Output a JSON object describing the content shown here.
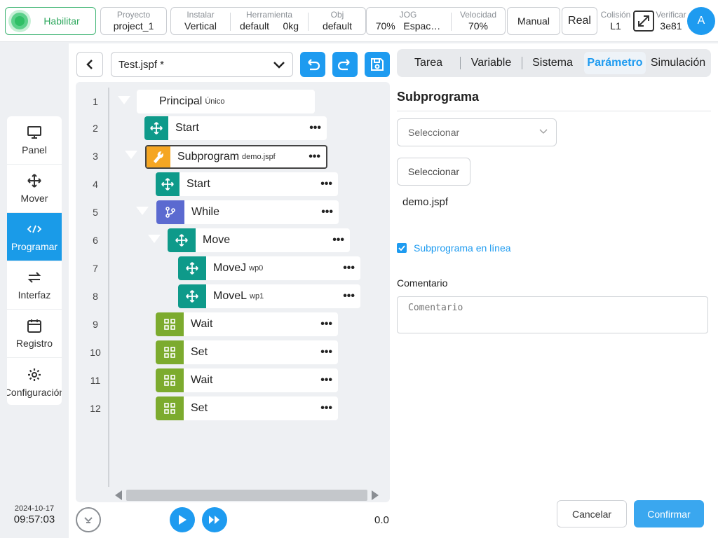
{
  "topbar": {
    "enable_label": "Habilitar",
    "project": {
      "label": "Proyecto",
      "value": "project_1"
    },
    "install": {
      "label": "Instalar",
      "value": "Vertical"
    },
    "tool": {
      "label": "Herramienta",
      "value": "default",
      "payload": "0kg"
    },
    "obj": {
      "label": "Obj",
      "value": "default"
    },
    "jog": {
      "label": "JOG",
      "value": "70%",
      "frame": "Espac…"
    },
    "speed": {
      "label": "Velocidad",
      "value": "70%"
    },
    "mode_manual": "Manual",
    "mode_real": "Real",
    "collision": {
      "label": "Colisión",
      "value": "L1"
    },
    "verify": {
      "label": "Verificar",
      "value": "3e81"
    },
    "avatar": "A",
    "expand_icon": "expand-icon"
  },
  "sidebar": {
    "items": [
      {
        "label": "Panel",
        "icon": "monitor-icon"
      },
      {
        "label": "Mover",
        "icon": "move-arrows-icon"
      },
      {
        "label": "Programar",
        "icon": "code-icon"
      },
      {
        "label": "Interfaz",
        "icon": "swap-arrows-icon"
      },
      {
        "label": "Registro",
        "icon": "calendar-icon"
      },
      {
        "label": "Configuración",
        "icon": "gear-icon"
      }
    ],
    "active_index": 2
  },
  "datetime": {
    "date": "2024-10-17",
    "time": "09:57:03"
  },
  "program": {
    "file": "Test.jspf *",
    "lines": [
      {
        "num": "1",
        "label": "Principal",
        "sub": "Único",
        "type": "root"
      },
      {
        "num": "2",
        "label": "Start",
        "sub": "",
        "type": "move"
      },
      {
        "num": "3",
        "label": "Subprogram",
        "sub": "demo.jspf",
        "type": "sub"
      },
      {
        "num": "4",
        "label": "Start",
        "sub": "",
        "type": "move"
      },
      {
        "num": "5",
        "label": "While",
        "sub": "",
        "type": "while"
      },
      {
        "num": "6",
        "label": "Move",
        "sub": "",
        "type": "move"
      },
      {
        "num": "7",
        "label": "MoveJ",
        "sub": "wp0",
        "type": "move"
      },
      {
        "num": "8",
        "label": "MoveL",
        "sub": "wp1",
        "type": "move"
      },
      {
        "num": "9",
        "label": "Wait",
        "sub": "",
        "type": "grid"
      },
      {
        "num": "10",
        "label": "Set",
        "sub": "",
        "type": "grid"
      },
      {
        "num": "11",
        "label": "Wait",
        "sub": "",
        "type": "grid"
      },
      {
        "num": "12",
        "label": "Set",
        "sub": "",
        "type": "grid"
      }
    ],
    "more_glyph": "•••",
    "speed_value": "0.0"
  },
  "right": {
    "tabs": [
      "Tarea",
      "Variable",
      "Sistema",
      "Parámetro",
      "Simulación"
    ],
    "active_tab": "Parámetro",
    "section_title": "Subprograma",
    "select_placeholder": "Seleccionar",
    "select_button": "Seleccionar",
    "file_name": "demo.jspf",
    "inline_label": "Subprograma en línea",
    "inline_checked": true,
    "comment_label": "Comentario",
    "comment_placeholder": "Comentario",
    "cancel": "Cancelar",
    "confirm": "Confirmar"
  },
  "colors": {
    "accent": "#1e9bf0",
    "move": "#0e9a8a",
    "sub": "#f5a623",
    "while": "#5b6ad0",
    "grid": "#7cab2e",
    "enable": "#2fbf65"
  }
}
